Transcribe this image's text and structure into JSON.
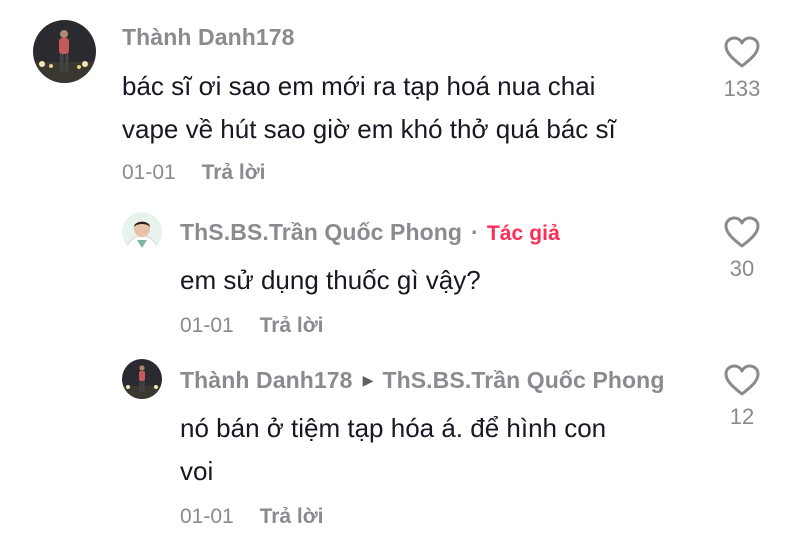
{
  "comments": [
    {
      "username": "Thành Danh178",
      "text_lines": [
        "bác sĩ ơi sao em mới ra tạp hoá nua chai",
        "vape về hút sao giờ em khó thở quá bác sĩ"
      ],
      "date": "01-01",
      "reply_label": "Trả lời",
      "likes": "133",
      "avatar": "avatar-photo-night"
    },
    {
      "username": "ThS.BS.Trần Quốc Phong",
      "badge": "Tác giả",
      "text_lines": [
        "em sử dụng thuốc gì vậy?"
      ],
      "date": "01-01",
      "reply_label": "Trả lời",
      "likes": "30",
      "avatar": "avatar-doctor"
    },
    {
      "username": "Thành Danh178",
      "reply_to": "ThS.BS.Trần Quốc Phong",
      "text_lines": [
        "nó bán ở tiệm tạp hóa á. để hình con",
        "voi"
      ],
      "date": "01-01",
      "reply_label": "Trả lời",
      "likes": "12",
      "avatar": "avatar-photo-night"
    }
  ],
  "colors": {
    "username": "#8a8b91",
    "text": "#161823",
    "author_badge": "#fe2c55"
  },
  "icons": {
    "like": "heart-outline-icon",
    "reply_arrow": "triangle-right-icon"
  }
}
